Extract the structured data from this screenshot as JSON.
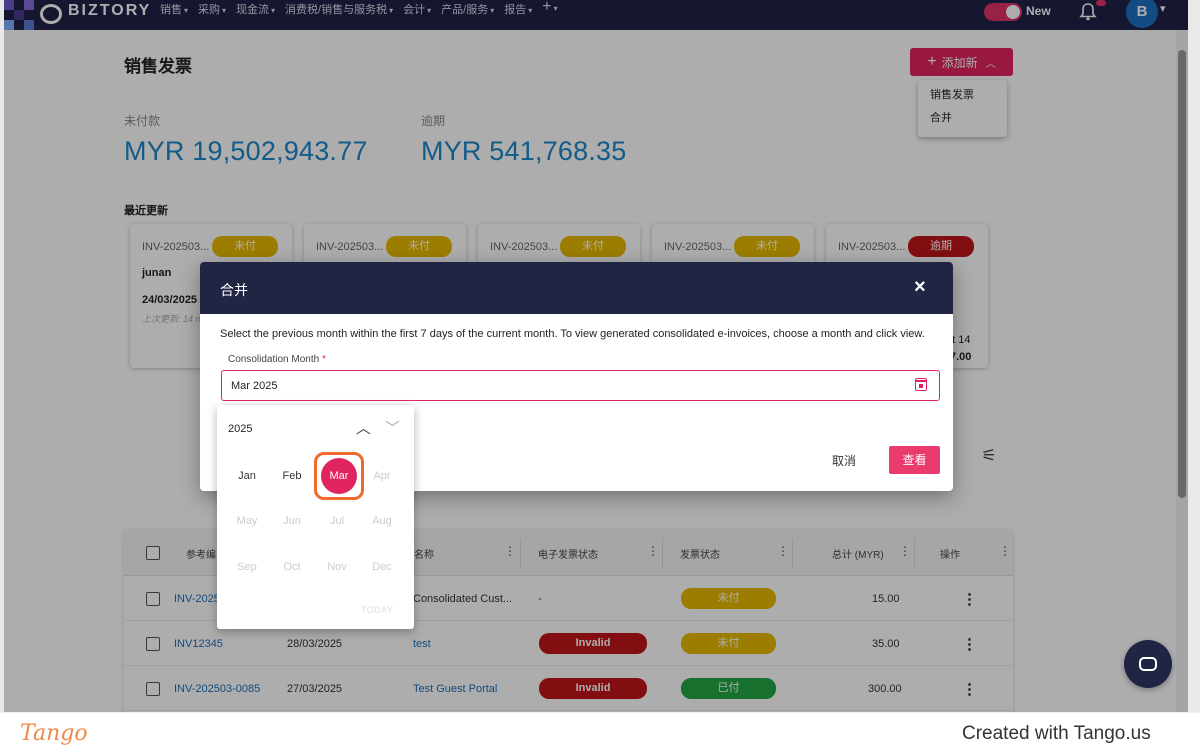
{
  "app": {
    "brand": "BIZTORY"
  },
  "nav": {
    "menu": [
      "销售",
      "采购",
      "现金流",
      "消费税/销售与服务税",
      "会计",
      "产品/服务",
      "报告",
      "+"
    ],
    "toggle_label": "New",
    "avatar_initial": "B"
  },
  "page": {
    "title": "销售发票",
    "add_button": "添加新",
    "add_menu": [
      "销售发票",
      "合并"
    ],
    "stats": [
      {
        "label": "未付款",
        "value": "MYR 19,502,943.77"
      },
      {
        "label": "逾期",
        "value": "MYR 541,768.35"
      }
    ],
    "recent_title": "最近更新"
  },
  "recent_cards": [
    {
      "id": "INV-202503...",
      "badge": "未付",
      "name": "junan",
      "date": "24/03/2025",
      "updated": "上次更新: 14 m",
      "date2": "",
      "amount": ""
    },
    {
      "id": "INV-202503...",
      "badge": "未付",
      "name": "",
      "date": "",
      "updated": "",
      "date2": "",
      "amount": ""
    },
    {
      "id": "INV-202503...",
      "badge": "未付",
      "name": "",
      "date": "",
      "updated": "",
      "date2": "",
      "amount": ""
    },
    {
      "id": "INV-202503...",
      "badge": "未付",
      "name": "",
      "date": "",
      "updated": "",
      "date2": "",
      "amount": ""
    },
    {
      "id": "INV-202503...",
      "badge": "逾期",
      "name": "",
      "date": "",
      "updated": "",
      "date2": "et 14",
      "amount": "7.00"
    }
  ],
  "table": {
    "headers": [
      "参考编...",
      "名称",
      "电子发票状态",
      "发票状态",
      "总计 (MYR)",
      "操作"
    ],
    "rows": [
      {
        "ref": "INV-20250",
        "date": "",
        "name": "Consolidated Cust...",
        "einvoice": "-",
        "status": "未付",
        "total": "15.00"
      },
      {
        "ref": "INV12345",
        "date": "28/03/2025",
        "name": "test",
        "einvoice": "Invalid",
        "status": "未付",
        "total": "35.00"
      },
      {
        "ref": "INV-202503-0085",
        "date": "27/03/2025",
        "name": "Test Guest Portal",
        "einvoice": "Invalid",
        "status": "已付",
        "total": "300.00"
      }
    ]
  },
  "modal": {
    "title": "合并",
    "close_icon": "×",
    "description": "Select the previous month within the first 7 days of the current month. To view generated consolidated e-invoices, choose a month and click view.",
    "field_label": "Consolidation Month",
    "required_mark": "*",
    "field_value": "Mar 2025",
    "cancel": "取消",
    "view": "查看"
  },
  "picker": {
    "year": "2025",
    "months": [
      "Jan",
      "Feb",
      "Mar",
      "Apr",
      "May",
      "Jun",
      "Jul",
      "Aug",
      "Sep",
      "Oct",
      "Nov",
      "Dec"
    ],
    "selected": "Mar",
    "today": "TODAY"
  },
  "footer": {
    "logo": "Tango",
    "credit": "Created with Tango.us"
  },
  "colors": {
    "nav": "#1f2348",
    "accent": "#e0245e",
    "stat": "#1d86c9",
    "unpaid": "#e6b800",
    "overdue": "#c0161a",
    "paid": "#22a544",
    "highlight": "#ef6a2c"
  }
}
